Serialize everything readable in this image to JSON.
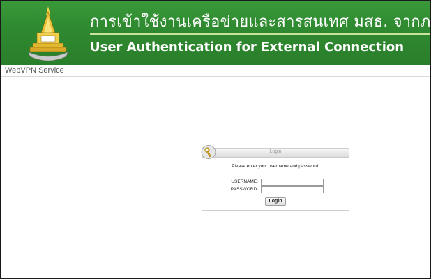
{
  "header": {
    "thai_title": "การเข้าใช้งานเครือข่ายและสารสนเทศ มสธ. จากภายนอก",
    "english_title": "User Authentication for External Connection",
    "logo_icon": "university-emblem-icon"
  },
  "service": {
    "label": "WebVPN Service"
  },
  "login": {
    "title": "Login",
    "key_icon": "key-icon",
    "prompt": "Please enter your username and password.",
    "username_label": "USERNAME:",
    "username_value": "",
    "password_label": "PASSWORD:",
    "password_value": "",
    "button_label": "Login"
  },
  "colors": {
    "banner_green": "#2f8a30",
    "divider": "#c9e49a"
  }
}
